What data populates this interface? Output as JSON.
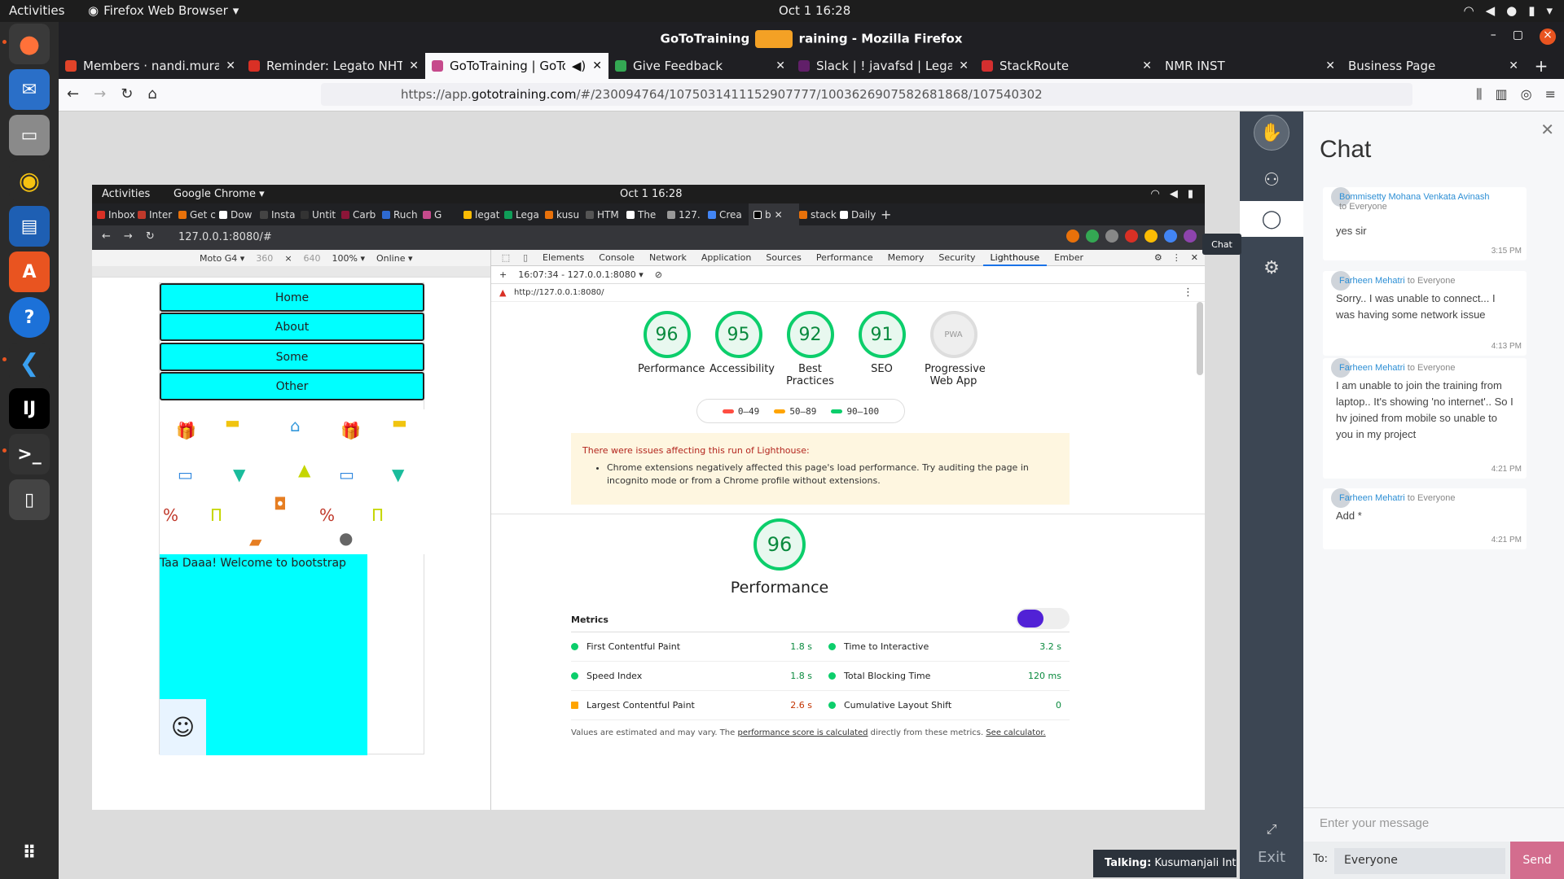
{
  "os": {
    "activities": "Activities",
    "app_name": "Firefox Web Browser",
    "clock": "Oct 1  16:28"
  },
  "firefox": {
    "title": "GoToTraining - Mozilla Firefox",
    "title_left": "GoToTraining",
    "title_right": "raining - Mozilla Firefox",
    "tabs": [
      {
        "label": "Members · nandi.muralid",
        "color": "#e24329"
      },
      {
        "label": "Reminder: Legato NHT W",
        "color": "#d93025"
      },
      {
        "label": "GoToTraining | GoToT",
        "color": "#c64a8c"
      },
      {
        "label": "Give Feedback",
        "color": "#34a853"
      },
      {
        "label": "Slack | ! javafsd | Legato",
        "color": "#611f69"
      },
      {
        "label": "StackRoute",
        "color": "#d32f2f"
      },
      {
        "label": "NMR INST",
        "color": "#888888"
      },
      {
        "label": "Business Page",
        "color": "#888888"
      }
    ],
    "url_prefix": "https://app.",
    "url_domain": "gototraining.com",
    "url_rest": "/#/230094764/1075031411152907777/100362690758268186​8/107540302"
  },
  "screen": {
    "activities": "Activities",
    "app": "Google Chrome ▾",
    "clock": "Oct 1  16:28",
    "tabs": [
      {
        "label": "Inbox",
        "color": "#d93025"
      },
      {
        "label": "Inter",
        "color": "#c0392b"
      },
      {
        "label": "Get c",
        "color": "#e8710a"
      },
      {
        "label": "Dow",
        "color": "#ffffff"
      },
      {
        "label": "Insta",
        "color": "#444444"
      },
      {
        "label": "Untit",
        "color": "#333333"
      },
      {
        "label": "Carb",
        "color": "#8b1538"
      },
      {
        "label": "Ruch",
        "color": "#2e6ad1"
      },
      {
        "label": "G",
        "color": "#c64a8c"
      },
      {
        "label": "legat",
        "color": "#fbbc04"
      },
      {
        "label": "Lega",
        "color": "#0f9d58"
      },
      {
        "label": "kusu",
        "color": "#e8710a"
      },
      {
        "label": "HTM",
        "color": "#555555"
      },
      {
        "label": "The",
        "color": "#ffffff"
      },
      {
        "label": "127.",
        "color": "#999999"
      },
      {
        "label": "Crea",
        "color": "#4285f4"
      },
      {
        "label": "b",
        "color": "#000000"
      },
      {
        "label": "stack",
        "color": "#e8710a"
      },
      {
        "label": "Daily",
        "color": "#ffffff"
      }
    ],
    "address": "127.0.0.1:8080/#",
    "device": {
      "model": "Moto G4 ▾",
      "width": "360",
      "x": "×",
      "height": "640",
      "zoom": "100% ▾",
      "network": "Online ▾"
    },
    "site": {
      "nav": [
        "Home",
        "About",
        "Some",
        "Other"
      ],
      "hero_text": "Taa Daaa! Welcome to bootstrap"
    },
    "devtools": {
      "tabs": [
        "Elements",
        "Console",
        "Network",
        "Application",
        "Sources",
        "Performance",
        "Memory",
        "Security",
        "Lighthouse",
        "Ember"
      ],
      "run": "16:07:34 - 127.0.0.1:8080 ▾",
      "page_url": "http://127.0.0.1:8080/",
      "gauges": [
        {
          "score": "96",
          "label": "Performance"
        },
        {
          "score": "95",
          "label": "Accessibility"
        },
        {
          "score": "92",
          "label": "Best Practices"
        },
        {
          "score": "91",
          "label": "SEO"
        },
        {
          "score": "PWA",
          "label": "Progressive Web App"
        }
      ],
      "legend": [
        {
          "range": "0–49",
          "color": "#ff4e42"
        },
        {
          "range": "50–89",
          "color": "#ffa400"
        },
        {
          "range": "90–100",
          "color": "#0cce6b"
        }
      ],
      "warning_title": "There were issues affecting this run of Lighthouse:",
      "warning_item": "Chrome extensions negatively affected this page's load performance. Try auditing the page in incognito mode or from a Chrome profile without extensions.",
      "perf_score": "96",
      "perf_title": "Performance",
      "metrics_title": "Metrics",
      "metrics": [
        {
          "name": "First Contentful Paint",
          "value": "1.8 s",
          "status": "good"
        },
        {
          "name": "Time to Interactive",
          "value": "3.2 s",
          "status": "good"
        },
        {
          "name": "Speed Index",
          "value": "1.8 s",
          "status": "good"
        },
        {
          "name": "Total Blocking Time",
          "value": "120 ms",
          "status": "good"
        },
        {
          "name": "Largest Contentful Paint",
          "value": "2.6 s",
          "status": "average"
        },
        {
          "name": "Cumulative Layout Shift",
          "value": "0",
          "status": "good"
        }
      ],
      "foot_a": "Values are estimated and may vary. The ",
      "foot_link1": "performance score is calculated",
      "foot_b": " directly from these metrics. ",
      "foot_link2": "See calculator."
    }
  },
  "chat": {
    "title": "Chat",
    "tooltip": "Chat",
    "messages": [
      {
        "from": "Bommisetty Mohana Venkata Avinash",
        "to": "to Everyone",
        "body": "yes sir",
        "time": "3:15 PM"
      },
      {
        "from": "Farheen Mehatri",
        "to": "to Everyone",
        "body": "Sorry.. I was unable to connect... I was having some network issue",
        "time": "4:13 PM"
      },
      {
        "from": "Farheen Mehatri",
        "to": "to Everyone",
        "body": "I am unable to join the training from laptop.. It's showing 'no internet'.. So I hv joined from mobile so unable to you in my project",
        "time": "4:21 PM"
      },
      {
        "from": "Farheen Mehatri",
        "to": "to Everyone",
        "body": "Add *",
        "time": "4:21 PM"
      }
    ],
    "input_placeholder": "Enter your message",
    "to_label": "To:",
    "to_value": "Everyone",
    "send": "Send",
    "exit": "Exit",
    "talking_label": "Talking:",
    "talking_name": "Kusumanjali Inti"
  }
}
